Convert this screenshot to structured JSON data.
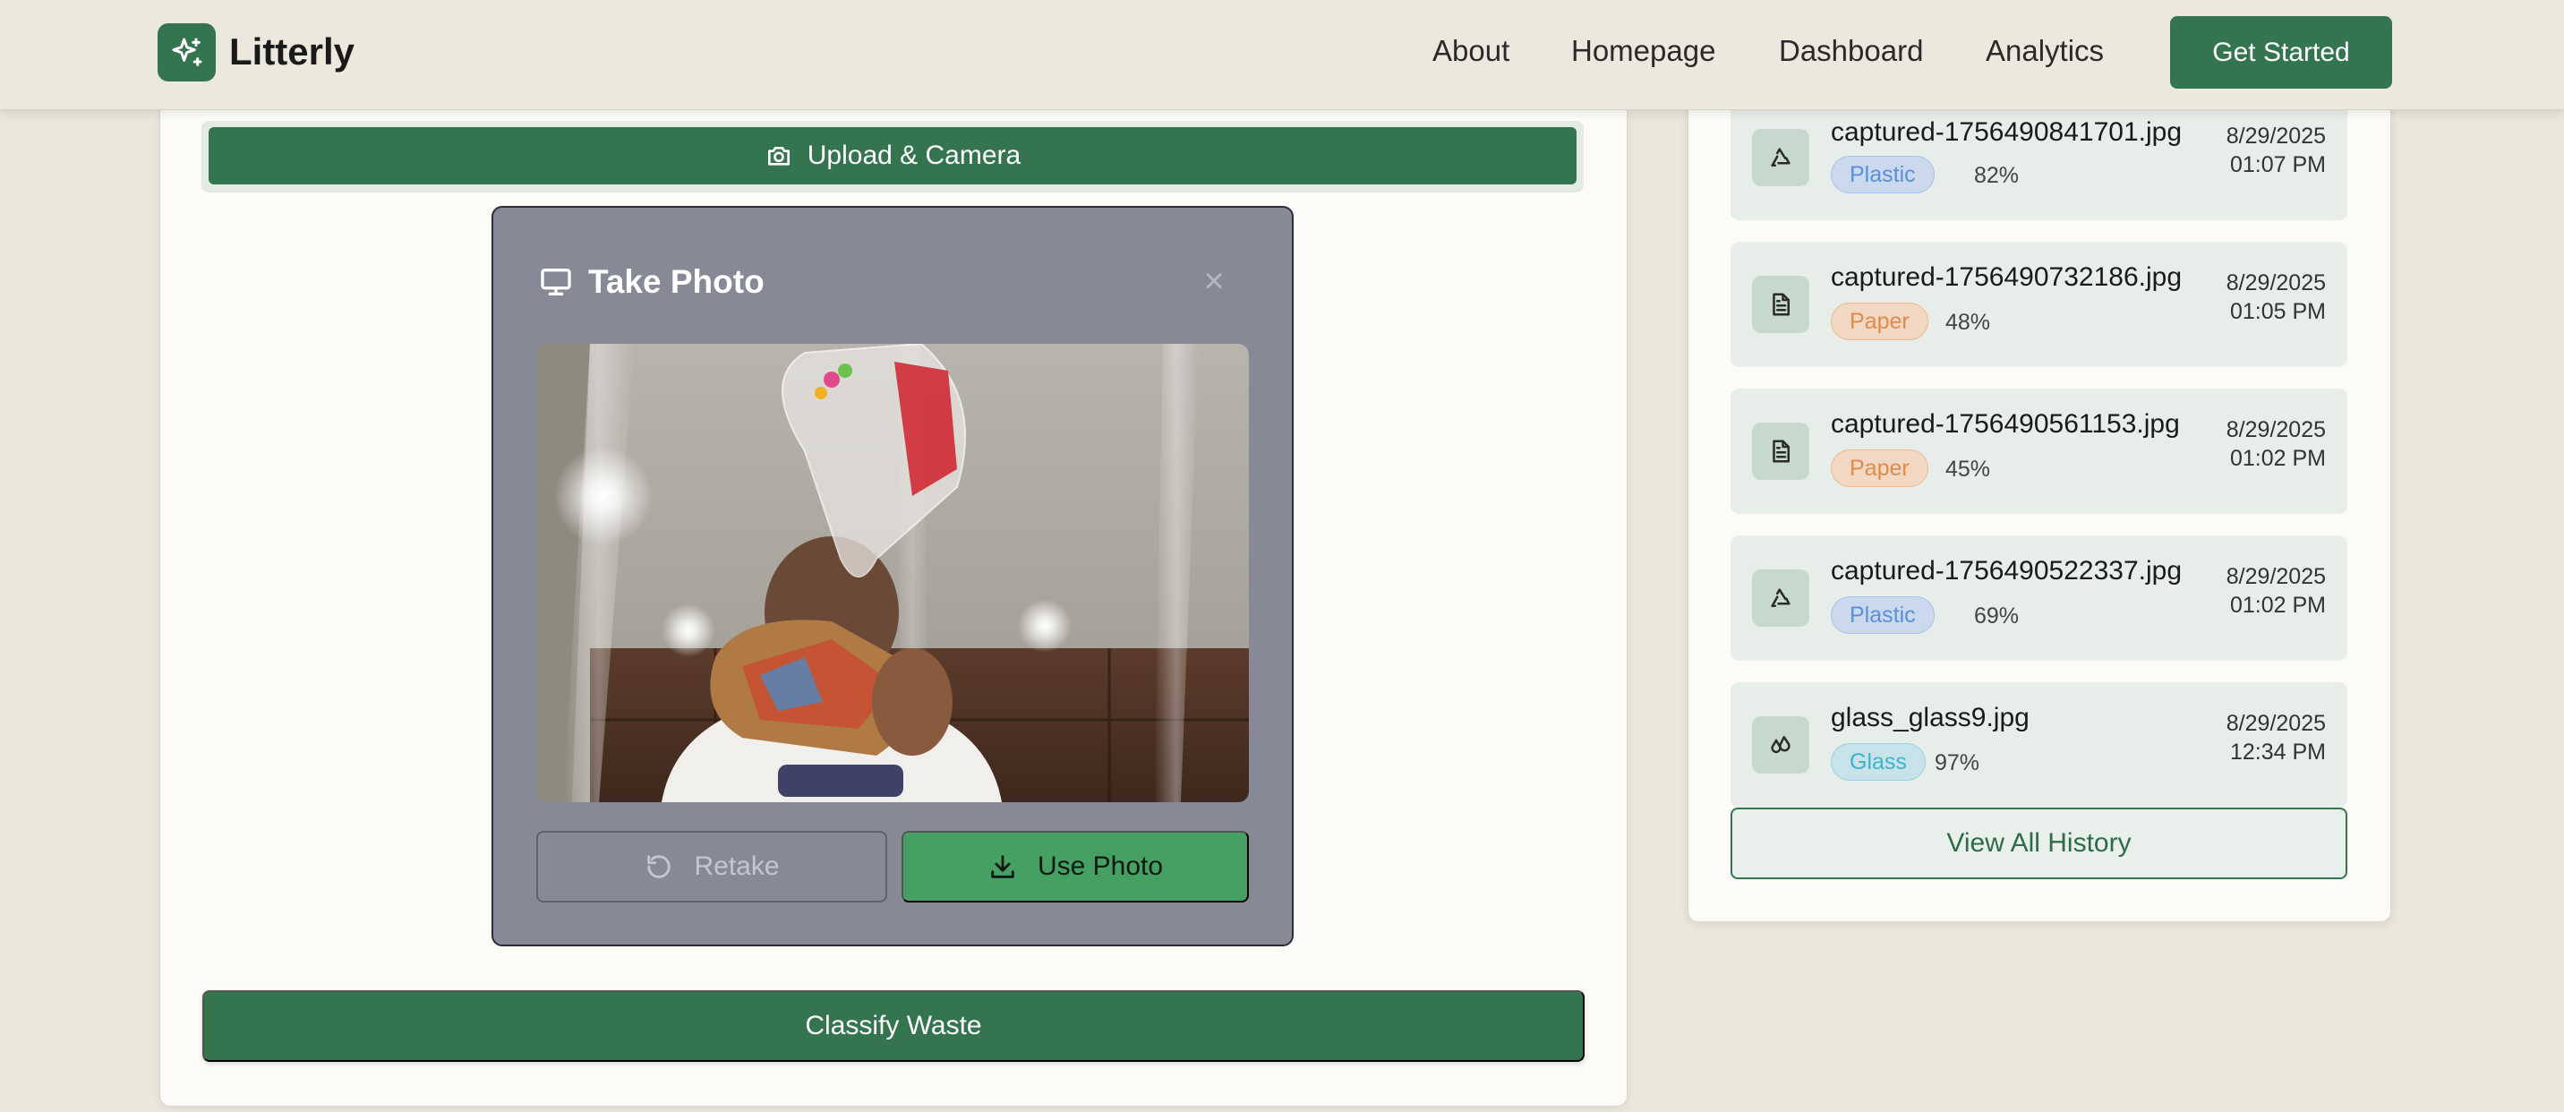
{
  "header": {
    "brand": "Litterly",
    "nav": [
      "About",
      "Homepage",
      "Dashboard",
      "Analytics"
    ],
    "cta_label": "Get Started"
  },
  "upload": {
    "tab_label": "Upload & Camera",
    "tab_icon": "camera-icon"
  },
  "modal": {
    "title": "Take Photo",
    "title_icon": "monitor-icon",
    "close_glyph": "×",
    "retake_label": "Retake",
    "use_label": "Use Photo"
  },
  "classify_label": "Classify Waste",
  "history": {
    "items": [
      {
        "name": "captured-1756490841701.jpg",
        "category": "Plastic",
        "confidence": "82%",
        "date": "8/29/2025",
        "time": "01:07 PM",
        "icon": "recycle-icon"
      },
      {
        "name": "captured-1756490732186.jpg",
        "category": "Paper",
        "confidence": "48%",
        "date": "8/29/2025",
        "time": "01:05 PM",
        "icon": "document-icon"
      },
      {
        "name": "captured-1756490561153.jpg",
        "category": "Paper",
        "confidence": "45%",
        "date": "8/29/2025",
        "time": "01:02 PM",
        "icon": "document-icon"
      },
      {
        "name": "captured-1756490522337.jpg",
        "category": "Plastic",
        "confidence": "69%",
        "date": "8/29/2025",
        "time": "01:02 PM",
        "icon": "recycle-icon"
      },
      {
        "name": "glass_glass9.jpg",
        "category": "Glass",
        "confidence": "97%",
        "date": "8/29/2025",
        "time": "12:34 PM",
        "icon": "glass-drop-icon"
      }
    ],
    "view_all_label": "View All History"
  },
  "colors": {
    "brand_green": "#34744f",
    "use_photo_green": "#46a064",
    "plastic": "#5b8fd9",
    "paper": "#e08a4c",
    "glass": "#3fb2cc"
  }
}
